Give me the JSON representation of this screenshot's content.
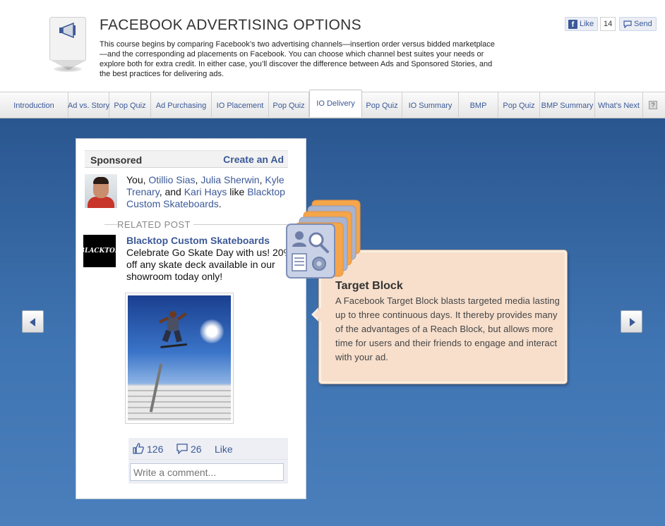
{
  "header": {
    "title": "FACEBOOK ADVERTISING OPTIONS",
    "description": "This course begins by comparing Facebook’s two advertising channels—insertion order versus bidded marketplace—and the corresponding ad placements on Facebook. You can choose which channel best suites your needs or explore both for extra credit. In either case, you’ll discover the difference between Ads and Sponsored Stories, and the best practices for delivering ads.",
    "like_label": "Like",
    "like_count": "14",
    "send_label": "Send"
  },
  "tabs": [
    {
      "label": "Introduction"
    },
    {
      "label": "Ad vs. Story"
    },
    {
      "label": "Pop Quiz"
    },
    {
      "label": "Ad Purchasing"
    },
    {
      "label": "IO Placement"
    },
    {
      "label": "Pop Quiz"
    },
    {
      "label": "IO Delivery",
      "active": true
    },
    {
      "label": "Pop Quiz"
    },
    {
      "label": "IO Summary"
    },
    {
      "label": "BMP"
    },
    {
      "label": "Pop Quiz"
    },
    {
      "label": "BMP Summary"
    },
    {
      "label": "What's Next"
    }
  ],
  "help_label": "?",
  "ad": {
    "sponsored_label": "Sponsored",
    "create_ad_label": "Create an Ad",
    "social": {
      "you": "You, ",
      "friend1": "Otillio Sias",
      "sep1": ", ",
      "friend2": "Julia Sherwin",
      "sep2": ", ",
      "friend3": "Kyle Trenary",
      "sep3": ", and ",
      "friend4": "Kari Hays",
      "like_word": " like ",
      "page": "Blacktop Custom Skateboards",
      "end": "."
    },
    "related_label": "RELATED POST",
    "brand_logo_text": "BLACKTOP",
    "brand_name": "Blacktop Custom Skateboards",
    "post_text": "Celebrate Go Skate Day with us! 20% off any skate deck available in our showroom today only!",
    "likes": "126",
    "comments": "26",
    "like_link": "Like",
    "comment_placeholder": "Write a comment..."
  },
  "info": {
    "title": "Target Block",
    "text": "A Facebook Target Block blasts targeted media lasting up to three continuous days. It thereby provides many of the advantages of a Reach Block, but allows more time for users and their friends to engage and interact with your ad."
  },
  "colors": {
    "fb_blue": "#3b5998",
    "stage_blue": "#3f74b2",
    "info_bg": "#f7dfcc",
    "stack_orange": "#f5a54a",
    "stack_blue": "#a8b4d0"
  },
  "icons": {
    "header": "megaphone-icon",
    "stack": "target-block-stack-icon",
    "prev": "arrow-left-icon",
    "next": "arrow-right-icon"
  }
}
